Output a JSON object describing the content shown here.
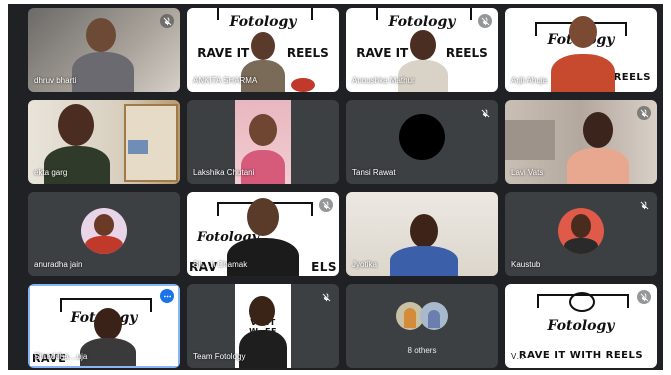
{
  "participants": [
    {
      "name": "dhruv bharti",
      "muted": true
    },
    {
      "name": "ANKITA SHARMA",
      "muted": false
    },
    {
      "name": "Anoushka Mathur",
      "muted": true
    },
    {
      "name": "Arjit Ahuja",
      "muted": false
    },
    {
      "name": "ekta garg",
      "muted": false
    },
    {
      "name": "Lakshika Chutani",
      "muted": false
    },
    {
      "name": "Tansi Rawat",
      "muted": true
    },
    {
      "name": "Lavi Vats",
      "muted": true
    },
    {
      "name": "anuradha jain",
      "muted": false
    },
    {
      "name": "Sh…h Chamak",
      "muted": true
    },
    {
      "name": "Jyotika",
      "muted": false
    },
    {
      "name": "Kaustub",
      "muted": true
    },
    {
      "name": "Shraddha…uja",
      "muted": false
    },
    {
      "name": "Team Fotology",
      "muted": true
    },
    {
      "name": "8 others",
      "muted": false
    },
    {
      "name": "V…",
      "muted": true
    }
  ],
  "poster": {
    "brand": "Fotology",
    "tagline": "RAVE IT WITH REELS",
    "tagline_partial_left": "RAVE IT ",
    "tagline_partial_right": "REELS"
  },
  "colors": {
    "stage_bg": "#202124",
    "tile_bg": "#3c4043",
    "active_border": "#8ab4f8",
    "more_button": "#1a73e8"
  }
}
